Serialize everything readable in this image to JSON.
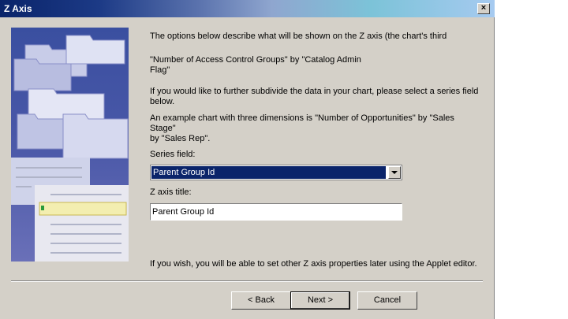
{
  "window": {
    "title": "Z Axis",
    "close_glyph": "×"
  },
  "content": {
    "intro": "The options below describe what will be shown on the Z axis (the chart's third",
    "fields_line1": "\"Number of Access Control Groups\" by \"Catalog Admin",
    "fields_line2": "Flag\"",
    "hint_line1": "If you would like to further subdivide the data in your chart, please select a series field",
    "hint_line2": "below.",
    "example_line1": "An example chart with three dimensions is \"Number of Opportunities\" by \"Sales Stage\"",
    "example_line2": "by \"Sales Rep\".",
    "series_label": "Series field:",
    "series_value": "Parent Group Id",
    "z_title_label": "Z axis title:",
    "z_title_value": "Parent Group Id",
    "footer_note": "If you wish, you will be able to set other Z axis properties later using the Applet editor."
  },
  "buttons": {
    "back": "< Back",
    "next": "Next >",
    "cancel": "Cancel"
  },
  "colors": {
    "title_bar_start": "#0a246a",
    "selection": "#0a246a",
    "dialog_bg": "#d4d0c8"
  }
}
